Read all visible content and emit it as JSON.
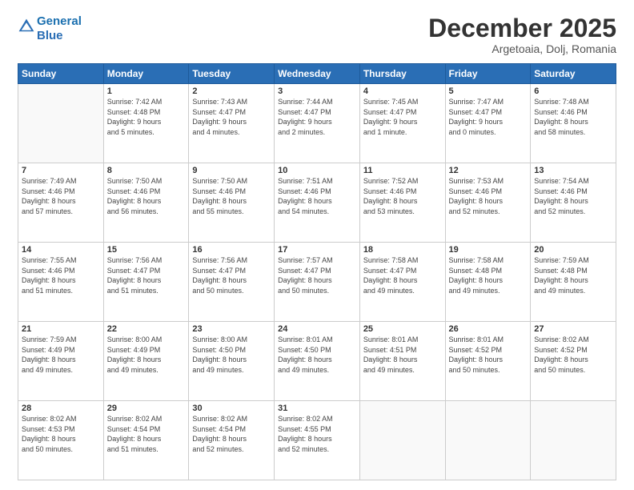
{
  "header": {
    "logo_line1": "General",
    "logo_line2": "Blue",
    "month": "December 2025",
    "location": "Argetoaia, Dolj, Romania"
  },
  "weekdays": [
    "Sunday",
    "Monday",
    "Tuesday",
    "Wednesday",
    "Thursday",
    "Friday",
    "Saturday"
  ],
  "weeks": [
    [
      {
        "day": "",
        "info": ""
      },
      {
        "day": "1",
        "info": "Sunrise: 7:42 AM\nSunset: 4:48 PM\nDaylight: 9 hours\nand 5 minutes."
      },
      {
        "day": "2",
        "info": "Sunrise: 7:43 AM\nSunset: 4:47 PM\nDaylight: 9 hours\nand 4 minutes."
      },
      {
        "day": "3",
        "info": "Sunrise: 7:44 AM\nSunset: 4:47 PM\nDaylight: 9 hours\nand 2 minutes."
      },
      {
        "day": "4",
        "info": "Sunrise: 7:45 AM\nSunset: 4:47 PM\nDaylight: 9 hours\nand 1 minute."
      },
      {
        "day": "5",
        "info": "Sunrise: 7:47 AM\nSunset: 4:47 PM\nDaylight: 9 hours\nand 0 minutes."
      },
      {
        "day": "6",
        "info": "Sunrise: 7:48 AM\nSunset: 4:46 PM\nDaylight: 8 hours\nand 58 minutes."
      }
    ],
    [
      {
        "day": "7",
        "info": "Sunrise: 7:49 AM\nSunset: 4:46 PM\nDaylight: 8 hours\nand 57 minutes."
      },
      {
        "day": "8",
        "info": "Sunrise: 7:50 AM\nSunset: 4:46 PM\nDaylight: 8 hours\nand 56 minutes."
      },
      {
        "day": "9",
        "info": "Sunrise: 7:50 AM\nSunset: 4:46 PM\nDaylight: 8 hours\nand 55 minutes."
      },
      {
        "day": "10",
        "info": "Sunrise: 7:51 AM\nSunset: 4:46 PM\nDaylight: 8 hours\nand 54 minutes."
      },
      {
        "day": "11",
        "info": "Sunrise: 7:52 AM\nSunset: 4:46 PM\nDaylight: 8 hours\nand 53 minutes."
      },
      {
        "day": "12",
        "info": "Sunrise: 7:53 AM\nSunset: 4:46 PM\nDaylight: 8 hours\nand 52 minutes."
      },
      {
        "day": "13",
        "info": "Sunrise: 7:54 AM\nSunset: 4:46 PM\nDaylight: 8 hours\nand 52 minutes."
      }
    ],
    [
      {
        "day": "14",
        "info": "Sunrise: 7:55 AM\nSunset: 4:46 PM\nDaylight: 8 hours\nand 51 minutes."
      },
      {
        "day": "15",
        "info": "Sunrise: 7:56 AM\nSunset: 4:47 PM\nDaylight: 8 hours\nand 51 minutes."
      },
      {
        "day": "16",
        "info": "Sunrise: 7:56 AM\nSunset: 4:47 PM\nDaylight: 8 hours\nand 50 minutes."
      },
      {
        "day": "17",
        "info": "Sunrise: 7:57 AM\nSunset: 4:47 PM\nDaylight: 8 hours\nand 50 minutes."
      },
      {
        "day": "18",
        "info": "Sunrise: 7:58 AM\nSunset: 4:47 PM\nDaylight: 8 hours\nand 49 minutes."
      },
      {
        "day": "19",
        "info": "Sunrise: 7:58 AM\nSunset: 4:48 PM\nDaylight: 8 hours\nand 49 minutes."
      },
      {
        "day": "20",
        "info": "Sunrise: 7:59 AM\nSunset: 4:48 PM\nDaylight: 8 hours\nand 49 minutes."
      }
    ],
    [
      {
        "day": "21",
        "info": "Sunrise: 7:59 AM\nSunset: 4:49 PM\nDaylight: 8 hours\nand 49 minutes."
      },
      {
        "day": "22",
        "info": "Sunrise: 8:00 AM\nSunset: 4:49 PM\nDaylight: 8 hours\nand 49 minutes."
      },
      {
        "day": "23",
        "info": "Sunrise: 8:00 AM\nSunset: 4:50 PM\nDaylight: 8 hours\nand 49 minutes."
      },
      {
        "day": "24",
        "info": "Sunrise: 8:01 AM\nSunset: 4:50 PM\nDaylight: 8 hours\nand 49 minutes."
      },
      {
        "day": "25",
        "info": "Sunrise: 8:01 AM\nSunset: 4:51 PM\nDaylight: 8 hours\nand 49 minutes."
      },
      {
        "day": "26",
        "info": "Sunrise: 8:01 AM\nSunset: 4:52 PM\nDaylight: 8 hours\nand 50 minutes."
      },
      {
        "day": "27",
        "info": "Sunrise: 8:02 AM\nSunset: 4:52 PM\nDaylight: 8 hours\nand 50 minutes."
      }
    ],
    [
      {
        "day": "28",
        "info": "Sunrise: 8:02 AM\nSunset: 4:53 PM\nDaylight: 8 hours\nand 50 minutes."
      },
      {
        "day": "29",
        "info": "Sunrise: 8:02 AM\nSunset: 4:54 PM\nDaylight: 8 hours\nand 51 minutes."
      },
      {
        "day": "30",
        "info": "Sunrise: 8:02 AM\nSunset: 4:54 PM\nDaylight: 8 hours\nand 52 minutes."
      },
      {
        "day": "31",
        "info": "Sunrise: 8:02 AM\nSunset: 4:55 PM\nDaylight: 8 hours\nand 52 minutes."
      },
      {
        "day": "",
        "info": ""
      },
      {
        "day": "",
        "info": ""
      },
      {
        "day": "",
        "info": ""
      }
    ]
  ]
}
